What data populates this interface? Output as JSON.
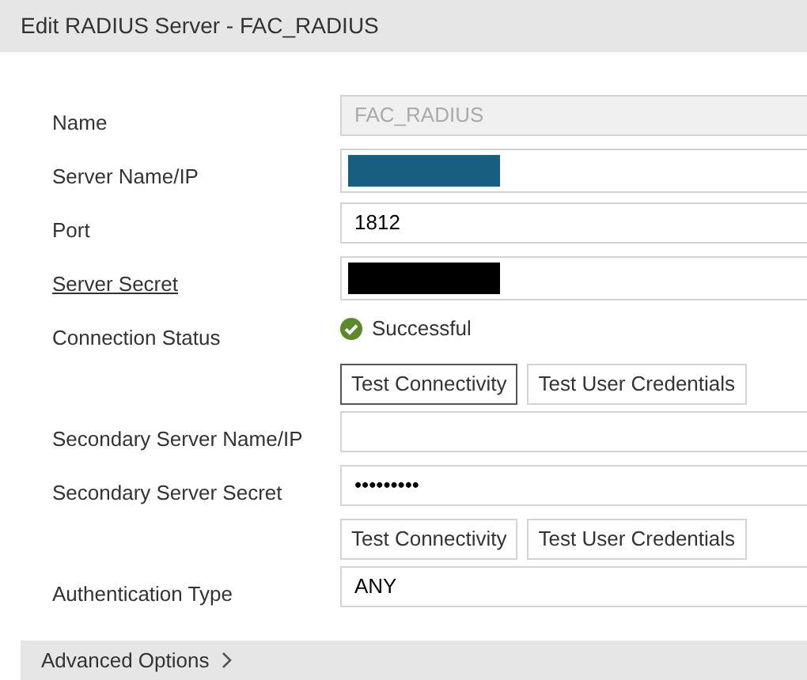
{
  "window": {
    "title": "Edit RADIUS Server - FAC_RADIUS"
  },
  "rows": [
    {
      "kind": "field",
      "label": "Name",
      "link": false,
      "value": "FAC_RADIUS",
      "disabled": true
    },
    {
      "kind": "redacted",
      "label": "Server Name/IP",
      "link": false,
      "color": "#175e80"
    },
    {
      "kind": "field",
      "label": "Port",
      "link": false,
      "value": "1812",
      "disabled": false
    },
    {
      "kind": "redacted",
      "label": "Server Secret",
      "link": true,
      "color": "#000000"
    },
    {
      "kind": "status",
      "label": "Connection Status",
      "link": false,
      "value": "Successful"
    },
    {
      "kind": "buttons",
      "buttons": [
        {
          "label": "Test Connectivity",
          "focused": true
        },
        {
          "label": "Test User Credentials",
          "focused": false
        }
      ]
    },
    {
      "kind": "field",
      "label": "Secondary Server Name/IP",
      "link": false,
      "disabled": false
    },
    {
      "kind": "field",
      "label": "Secondary Server Secret",
      "link": false,
      "value": "•••••••••",
      "disabled": false
    },
    {
      "kind": "buttons",
      "buttons": [
        {
          "label": "Test Connectivity",
          "focused": false
        },
        {
          "label": "Test User Credentials",
          "focused": false
        }
      ]
    },
    {
      "kind": "field",
      "label": "Authentication Type",
      "link": false,
      "value": "ANY",
      "disabled": false
    }
  ],
  "advanced": {
    "label": "Advanced Options",
    "expanded": false
  }
}
